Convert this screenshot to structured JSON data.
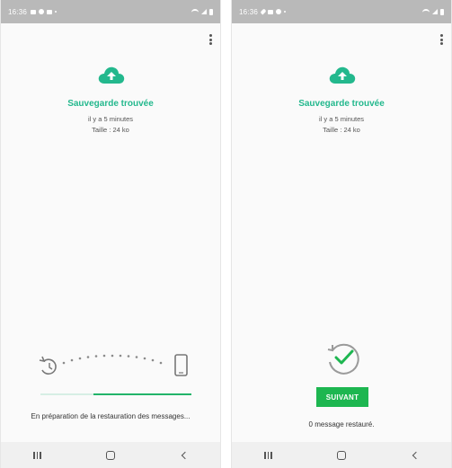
{
  "colors": {
    "accent": "#23b88d",
    "button": "#1db650",
    "status_bar": "#b9b9b9"
  },
  "screens": [
    {
      "status_time": "16:36",
      "backup_title": "Sauvegarde trouvée",
      "backup_age": "il y a 5 minutes",
      "backup_size": "Taille : 24 ko",
      "progress_percent": 65,
      "status_message": "En préparation de la restauration des messages..."
    },
    {
      "status_time": "16:36",
      "backup_title": "Sauvegarde trouvée",
      "backup_age": "il y a 5 minutes",
      "backup_size": "Taille : 24 ko",
      "next_label": "SUIVANT",
      "restored_message": "0 message restauré."
    }
  ],
  "icons": {
    "menu": "more-vert-icon",
    "backup": "cloud-upload-icon",
    "history": "history-icon",
    "phone": "phone-icon",
    "done": "restore-check-icon",
    "nav": [
      "recent-apps-icon",
      "home-icon",
      "back-icon"
    ]
  }
}
